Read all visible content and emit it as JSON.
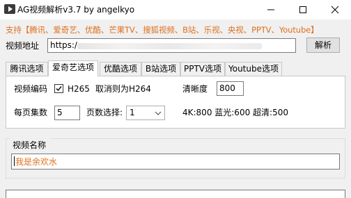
{
  "window": {
    "title": "AG视频解析v3.7 by angelkyo"
  },
  "support_text": "支持【腾讯、爱奇艺、优酷、芒果TV、搜狐视频、B站、乐视、央视、PPTV、Youtube】",
  "url": {
    "label": "视频地址",
    "value": "https:/"
  },
  "parse_button": "解析",
  "tabs": [
    "腾讯选项",
    "爱奇艺选项",
    "优酷选项",
    "B站选项",
    "PPTV选项",
    "Youtube选项"
  ],
  "active_tab": 1,
  "options": {
    "codec_label": "视频编码",
    "h265_label": "H265",
    "h265_checked": true,
    "cancel_hint": "取消则为H264",
    "clarity_label": "清晰度",
    "clarity_value": "800",
    "per_page_label": "每页集数",
    "per_page_value": "5",
    "page_select_label": "页数选择:",
    "page_select_value": "1",
    "quality_hint": "4K:800 蓝光:600 超清:500"
  },
  "video_name": {
    "label": "视频名称",
    "value": "我是余欢水"
  },
  "colors": {
    "accent_orange": "#e0701f",
    "window_bg": "#f0f0f0"
  }
}
